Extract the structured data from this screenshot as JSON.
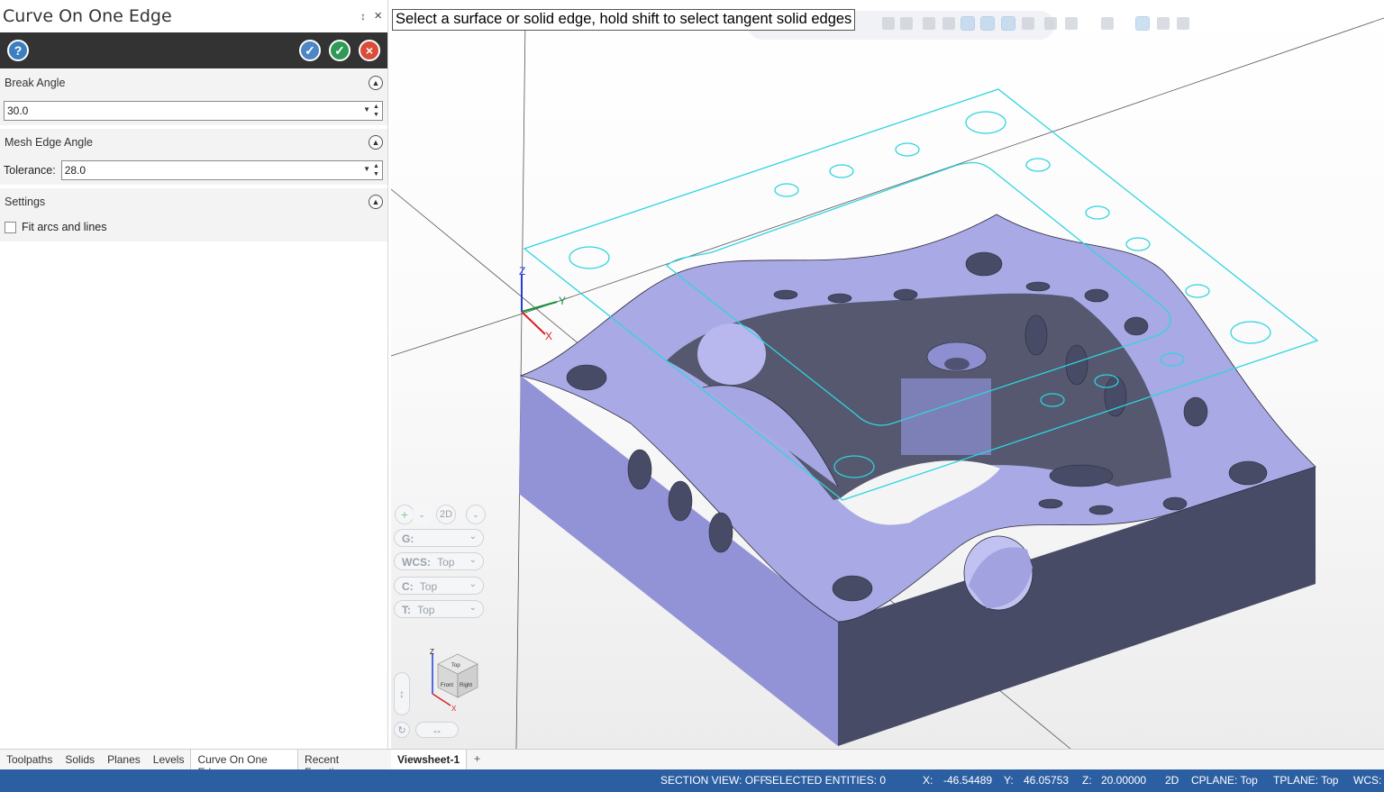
{
  "panel": {
    "title": "Curve On One Edge",
    "pin_glyph": "↕",
    "close_glyph": "×",
    "help_glyph": "?",
    "ok_new_glyph": "✓",
    "ok_glyph": "✓",
    "cancel_glyph": "×",
    "sections": {
      "break_angle": {
        "title": "Break Angle",
        "value": "30.0"
      },
      "mesh_edge_angle": {
        "title": "Mesh Edge Angle",
        "tolerance_label": "Tolerance:",
        "tolerance_value": "28.0"
      },
      "settings": {
        "title": "Settings",
        "fit_arcs_label": "Fit arcs and lines",
        "fit_arcs_checked": false
      }
    }
  },
  "bottom_tabs": [
    "Toolpaths",
    "Solids",
    "Planes",
    "Levels",
    "Curve On One Edge",
    "Recent Functions"
  ],
  "active_bottom_tab": "Curve On One Edge",
  "viewport": {
    "prompt": "Select a surface or solid edge, hold shift to select tangent solid edges",
    "axis_labels": {
      "x": "X",
      "y": "Y",
      "z": "Z"
    },
    "view_controls": {
      "g_label": "G:",
      "wcs_label": "WCS:",
      "wcs_value": "Top",
      "c_label": "C:",
      "c_value": "Top",
      "t_label": "T:",
      "t_value": "Top",
      "mode_2d": "2D"
    },
    "viewcube": {
      "top": "Top",
      "front": "Front",
      "right": "Right",
      "z": "Z",
      "x": "X"
    },
    "colors": {
      "solid_top": "#a9a9e6",
      "solid_side": "#8f8fd4",
      "solid_dark": "#474b66",
      "wire": "#2fd4e0"
    }
  },
  "sheet_tabs": {
    "active": "Viewsheet-1",
    "add": "+"
  },
  "status": {
    "section_view": "SECTION VIEW: OFF",
    "selected": "SELECTED ENTITIES: 0",
    "x_label": "X:",
    "x_value": "-46.54489",
    "y_label": "Y:",
    "y_value": "46.05753",
    "z_label": "Z:",
    "z_value": "20.00000",
    "mode": "2D",
    "cplane": "CPLANE: Top",
    "tplane": "TPLANE: Top",
    "wcs": "WCS: T"
  }
}
